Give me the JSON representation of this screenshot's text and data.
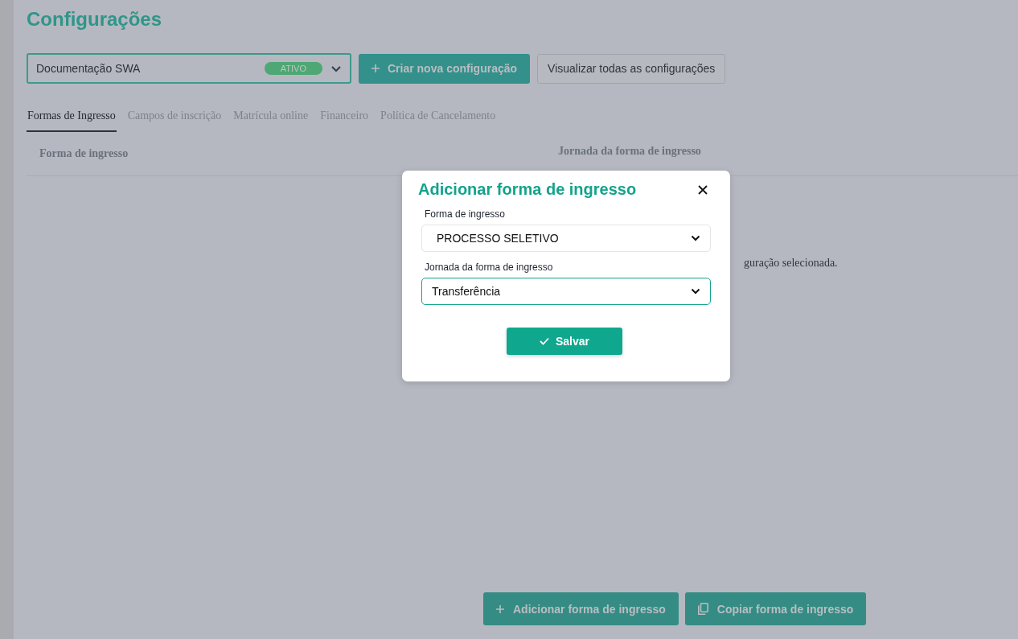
{
  "page": {
    "title": "Configurações"
  },
  "config_select": {
    "value": "Documentação SWA",
    "status": "ATIVO"
  },
  "toolbar_buttons": [
    {
      "label": "Criar nova configuração",
      "kind": "primary"
    },
    {
      "label": "Visualizar todas as configurações",
      "kind": "secondary"
    }
  ],
  "tabs": [
    {
      "label": "Formas de Ingresso",
      "selected": true
    },
    {
      "label": "Campos de inscrição",
      "selected": false
    },
    {
      "label": "Matrícula online",
      "selected": false
    },
    {
      "label": "Financeiro",
      "selected": false
    },
    {
      "label": "Política de Cancelamento",
      "selected": false
    }
  ],
  "table": {
    "columns": [
      "Forma de ingresso",
      "Jornada da forma de ingresso"
    ],
    "empty_message": "guração selecionada."
  },
  "bottom_buttons": [
    {
      "label": "Adicionar forma de ingresso",
      "kind": "add"
    },
    {
      "label": "Copiar forma de ingresso",
      "kind": "copy"
    }
  ],
  "modal": {
    "title": "Adicionar forma de ingresso",
    "fields": [
      {
        "label": "Forma de ingresso",
        "value": "PROCESSO SELETIVO",
        "focused": false
      },
      {
        "label": "Jornada da forma de ingresso",
        "value": "Transferência",
        "focused": true
      }
    ],
    "save_button": "Salvar"
  }
}
